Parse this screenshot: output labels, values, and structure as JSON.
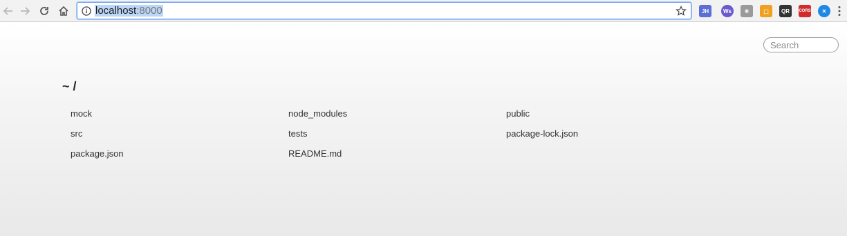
{
  "browser": {
    "url_host": "localhost",
    "url_port": ":8000",
    "icons": {
      "back": "back-arrow-icon",
      "forward": "forward-arrow-icon",
      "reload": "reload-icon",
      "home": "home-icon",
      "info": "info-icon",
      "bookmark": "star-icon",
      "menu": "menu-dots-icon"
    },
    "extensions": [
      {
        "label": "JH",
        "color": "#5b6fd6"
      },
      {
        "label": "Ws",
        "color": "#6a5acd"
      },
      {
        "label": "⚛",
        "color": "#9a9a9a"
      },
      {
        "label": "⬚",
        "color": "#f0a020"
      },
      {
        "label": "QR",
        "color": "#333333"
      },
      {
        "label": "CORS",
        "color": "#d22b2b"
      },
      {
        "label": "✕",
        "color": "#1e88e5"
      }
    ]
  },
  "page": {
    "search_placeholder": "Search",
    "path_title": "~ /",
    "files": [
      "mock",
      "node_modules",
      "public",
      "src",
      "tests",
      "package-lock.json",
      "package.json",
      "README.md"
    ]
  }
}
